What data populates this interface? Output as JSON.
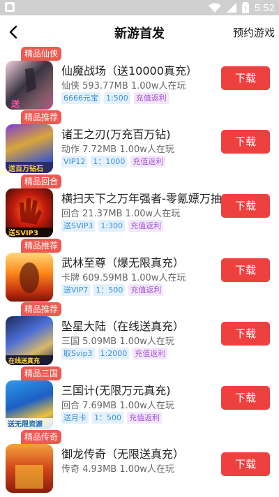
{
  "statusbar": {
    "time": "5:52"
  },
  "header": {
    "title": "新游首发",
    "reserve_label": "预约游戏"
  },
  "colors": {
    "accent": "#ef4040",
    "badge": "#ef5a50",
    "tag_blue": "#3b8fdc",
    "tag_purple": "#a657d6"
  },
  "games": [
    {
      "badge": "精品仙侠",
      "name": "仙魔战场（送10000真充）",
      "meta": "仙侠 593.77MB 1.00w人在玩",
      "tags": [
        "6666元宝",
        "1:500",
        "充值返利"
      ],
      "download": "下载"
    },
    {
      "badge": "精品推荐",
      "name": "诸王之刃(万充百万钻)",
      "meta": "动作 7.72MB 1.00w人在玩",
      "tags": [
        "VIP12",
        "1：1000",
        "充值返利"
      ],
      "download": "下载"
    },
    {
      "badge": "精品回合",
      "name": "横扫天下之万年强者-零氪嫖万抽",
      "meta": "回合 21.37MB 1.00w人在玩",
      "tags": [
        "送SVIP3",
        "1:300",
        "充值返利"
      ],
      "download": "下载"
    },
    {
      "badge": "精品推荐",
      "name": "武林至尊（爆无限真充）",
      "meta": "卡牌 609.59MB 1.00w人在玩",
      "tags": [
        "送VIP7",
        "1：500",
        "充值返利"
      ],
      "download": "下载"
    },
    {
      "badge": "精品推荐",
      "name": "坠星大陆（在线送真充）",
      "meta": "三国 5.09MB 1.00w人在玩",
      "tags": [
        "取Svip3",
        "1:2000",
        "充值返利"
      ],
      "download": "下载"
    },
    {
      "badge": "精品三国",
      "name": "三国计(无限万元真充)",
      "meta": "回合 7.69MB 1.00w人在玩",
      "tags": [
        "送月卡",
        "1：500",
        "充值返利"
      ],
      "download": "下载"
    },
    {
      "badge": "精品传奇",
      "name": "御龙传奇（无限送真充）",
      "meta": "传奇 4.93MB 1.00w人在玩",
      "tags": [],
      "download": "下载"
    }
  ]
}
